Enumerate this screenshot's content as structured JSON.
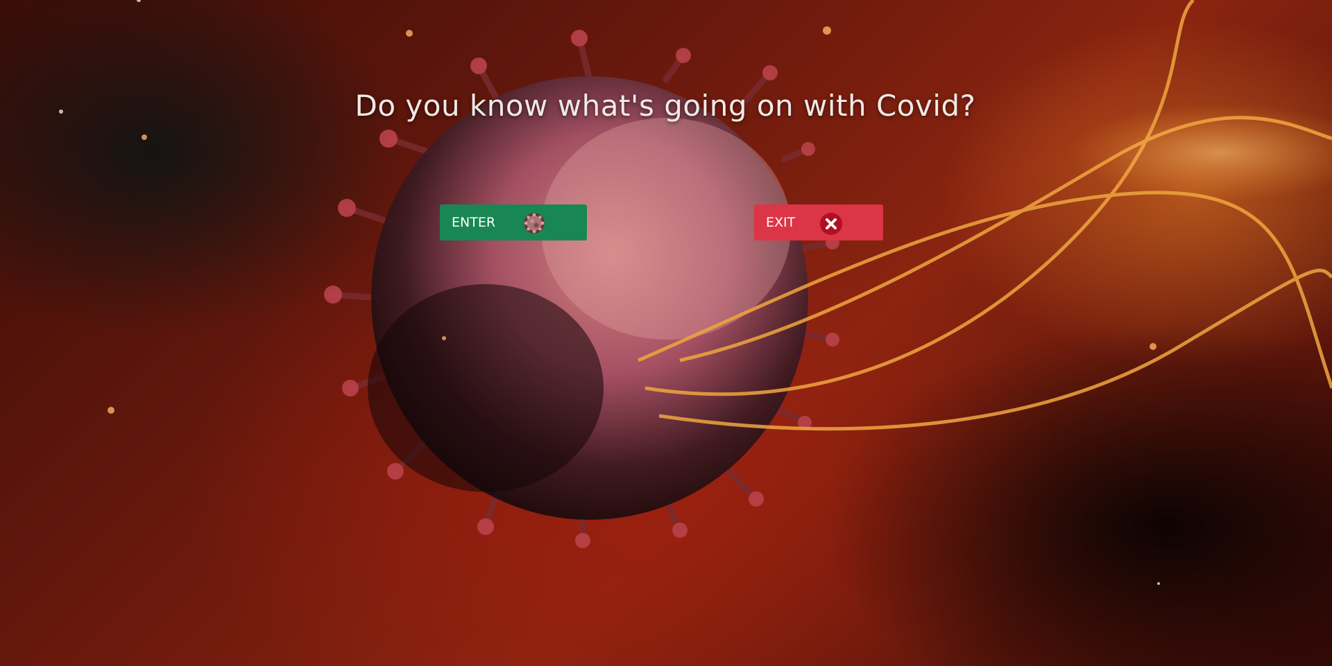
{
  "hero": {
    "title": "Do you know what's going on with Covid?"
  },
  "actions": {
    "enter_label": "ENTER",
    "exit_label": "EXIT",
    "enter_icon": "virus-icon",
    "exit_icon": "close-circle-icon"
  },
  "colors": {
    "enter": "#198754",
    "exit": "#dc3545",
    "title": "#f1e9e6"
  }
}
